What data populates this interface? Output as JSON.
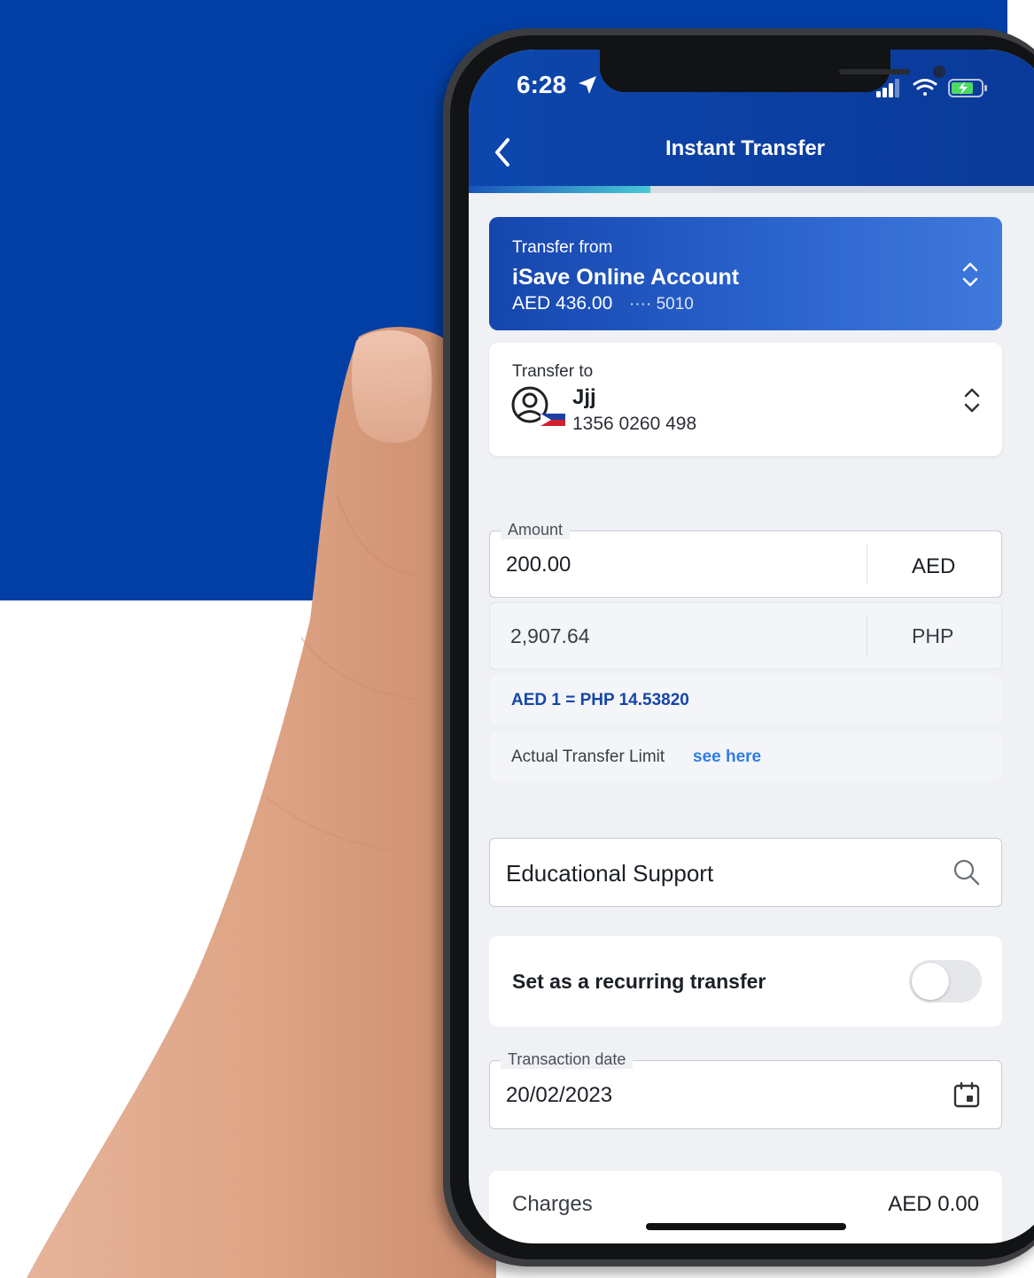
{
  "status_bar": {
    "time": "6:28"
  },
  "header": {
    "title": "Instant Transfer",
    "progress_fraction": 0.31
  },
  "transfer_from": {
    "label": "Transfer from",
    "account_name": "iSave Online Account",
    "balance": "AED 436.00",
    "masked_digits": "···· 5010"
  },
  "transfer_to": {
    "label": "Transfer to",
    "recipient_name": "Jjj",
    "account_number": "1356 0260 498"
  },
  "amount": {
    "label": "Amount",
    "value": "200.00",
    "currency": "AED",
    "converted_value": "2,907.64",
    "converted_currency": "PHP"
  },
  "exchange_rate": "AED 1 = PHP 14.53820",
  "limit": {
    "text": "Actual Transfer Limit",
    "link": "see here"
  },
  "purpose": {
    "value": "Educational Support"
  },
  "recurring": {
    "label": "Set as a recurring transfer",
    "enabled": false
  },
  "transaction_date": {
    "label": "Transaction date",
    "value": "20/02/2023"
  },
  "charges": {
    "label": "Charges",
    "value": "AED 0.00"
  },
  "colors": {
    "brand_blue": "#023fa5",
    "link_blue": "#2f7de1",
    "rate_blue": "#1646a8"
  }
}
